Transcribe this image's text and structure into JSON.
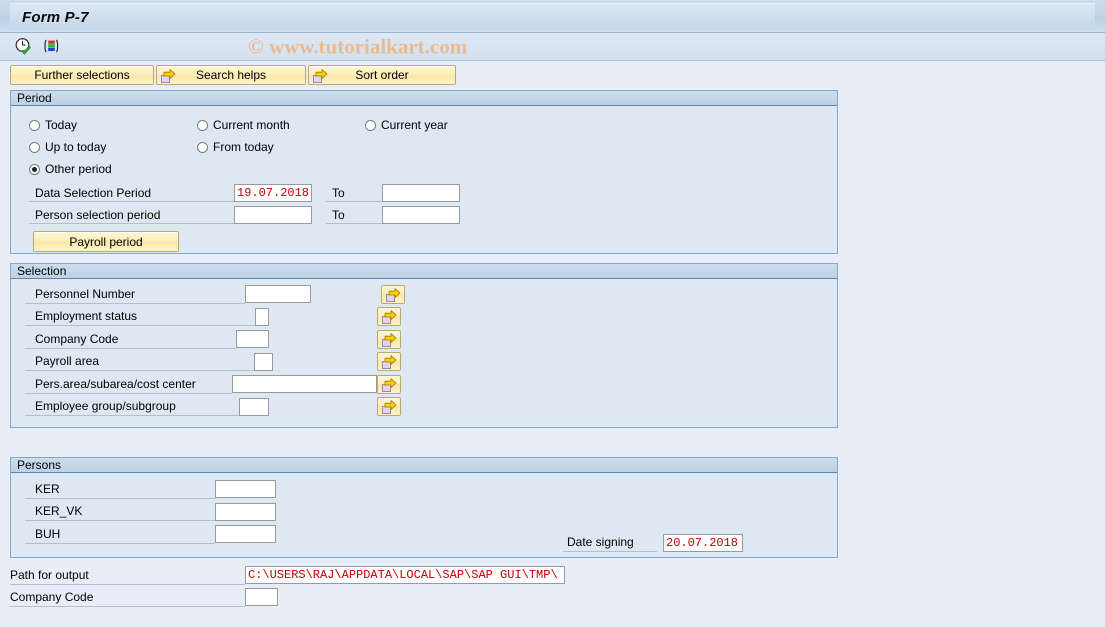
{
  "window": {
    "title": "Form P-7"
  },
  "watermark": {
    "text": "© www.tutorialkart.com"
  },
  "toolbar": {
    "icons": [
      {
        "name": "execute-clock-icon",
        "title": "Execute"
      },
      {
        "name": "execute-variant-icon",
        "title": "Execute with variant"
      }
    ]
  },
  "action_buttons": [
    {
      "label": "Further selections",
      "icon": null
    },
    {
      "label": "Search helps",
      "icon": "arrow-right-icon"
    },
    {
      "label": "Sort order",
      "icon": "arrow-right-icon"
    }
  ],
  "period": {
    "header": "Period",
    "radios": [
      {
        "label": "Today",
        "selected": false
      },
      {
        "label": "Current month",
        "selected": false
      },
      {
        "label": "Current year",
        "selected": false
      },
      {
        "label": "Up to today",
        "selected": false
      },
      {
        "label": "From today",
        "selected": false
      },
      {
        "label": "Other period",
        "selected": true
      }
    ],
    "fields": [
      {
        "label": "Data Selection Period",
        "value": "19.07.2018",
        "to_label": "To",
        "to_value": ""
      },
      {
        "label": "Person selection period",
        "value": "",
        "to_label": "To",
        "to_value": ""
      }
    ],
    "payroll_button": "Payroll period"
  },
  "selection": {
    "header": "Selection",
    "rows": [
      {
        "label": "Personnel Number",
        "value": "",
        "input_width": 66,
        "label_width": 220,
        "multi": "arrow-right-icon"
      },
      {
        "label": "Employment status",
        "value": "",
        "input_width": 14,
        "label_width": 220,
        "multi": "arrow-right-icon"
      },
      {
        "label": "Company Code",
        "value": "",
        "input_width": 33,
        "label_width": 201,
        "multi": "arrow-right-icon"
      },
      {
        "label": "Payroll area",
        "value": "",
        "input_width": 19,
        "label_width": 215,
        "multi": "arrow-right-icon"
      },
      {
        "label": "Pers.area/subarea/cost center",
        "value": "",
        "input_width": 145,
        "label_width": 89,
        "multi": "arrow-right-icon"
      },
      {
        "label": "Employee group/subgroup",
        "value": "",
        "input_width": 30,
        "label_width": 204,
        "multi": "arrow-right-icon"
      }
    ]
  },
  "persons": {
    "header": "Persons",
    "rows": [
      {
        "label": "KER",
        "value": ""
      },
      {
        "label": "KER_VK",
        "value": ""
      },
      {
        "label": "BUH",
        "value": ""
      }
    ],
    "date_signing": {
      "label": "Date signing",
      "value": "20.07.2018"
    }
  },
  "footer": {
    "path_label": "Path for output",
    "path_value": "C:\\USERS\\RAJ\\APPDATA\\LOCAL\\SAP\\SAP GUI\\TMP\\",
    "company_code_label": "Company Code",
    "company_code_value": ""
  },
  "colors": {
    "page_bg": "#e8eef7",
    "panel_bg": "#dde8f2",
    "panel_border": "#86a7c6",
    "group_header": "#c6d8ea",
    "button_yellow": "#fbeeb9",
    "input_text_red": "#c00000",
    "watermark": "#edb27e"
  }
}
